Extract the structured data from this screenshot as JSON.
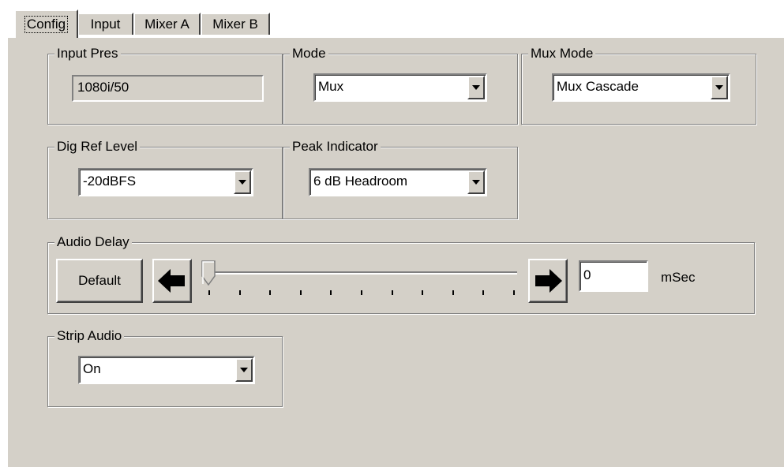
{
  "tabs": [
    "Config",
    "Input",
    "Mixer A",
    "Mixer B"
  ],
  "input_pres": {
    "label": "Input Pres",
    "value": "1080i/50"
  },
  "mode": {
    "label": "Mode",
    "value": "Mux"
  },
  "mux_mode": {
    "label": "Mux Mode",
    "value": "Mux Cascade"
  },
  "dig_ref_level": {
    "label": "Dig Ref Level",
    "value": "-20dBFS"
  },
  "peak_indicator": {
    "label": "Peak Indicator",
    "value": "6 dB Headroom"
  },
  "audio_delay": {
    "label": "Audio Delay",
    "default_button": "Default",
    "value": "0",
    "unit": "mSec",
    "slider_level": 0
  },
  "strip_audio": {
    "label": "Strip Audio",
    "value": "On"
  }
}
